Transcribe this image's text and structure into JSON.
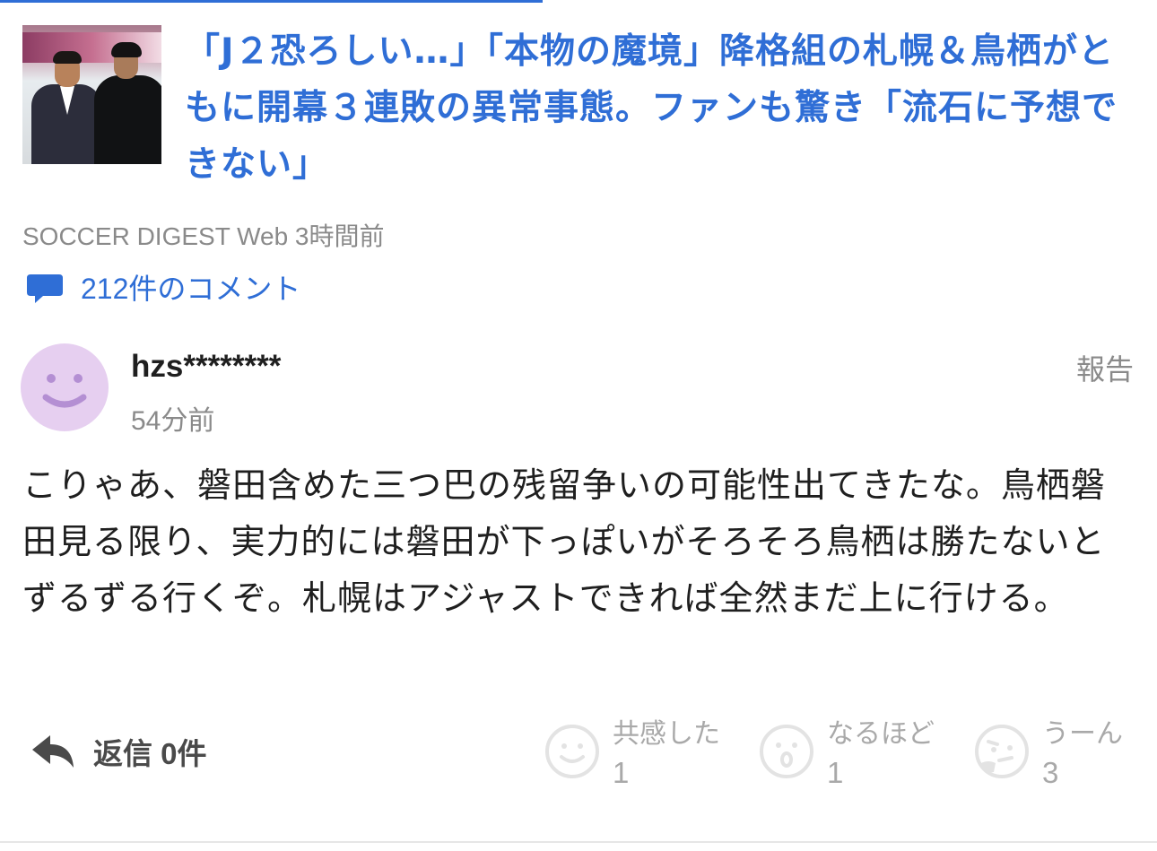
{
  "article": {
    "thumbnail_icon": "article-photo",
    "title": "「J２恐ろしい…」「本物の魔境」降格組の札幌＆鳥栖がともに開幕３連敗の異常事態。ファンも驚き「流石に予想できない」",
    "meta": "SOCCER DIGEST Web 3時間前",
    "comments_link": "212件のコメント",
    "comments_icon": "speech-bubble-icon"
  },
  "comment": {
    "avatar_icon": "smiley-avatar",
    "username": "hzs********",
    "time": "54分前",
    "report": "報告",
    "body": "こりゃあ、磐田含めた三つ巴の残留争いの可能性出てきたな。鳥栖磐田見る限り、実力的には磐田が下っぽいがそろそろ鳥栖は勝たないとずるずる行くぞ。札幌はアジャストできれば全然まだ上に行ける。",
    "reply": {
      "icon": "reply-arrow-icon",
      "label": "返信 0件"
    },
    "reactions": [
      {
        "icon": "smile-face-icon",
        "label": "共感した",
        "count": "1"
      },
      {
        "icon": "surprised-face-icon",
        "label": "なるほど",
        "count": "1"
      },
      {
        "icon": "thinking-face-icon",
        "label": "うーん",
        "count": "3"
      }
    ]
  },
  "colors": {
    "link": "#2f6ed6",
    "muted": "#8a8a8a",
    "reaction": "#a9a9a9",
    "avatar_bg": "#e6cff0",
    "avatar_face": "#b48fd3"
  }
}
